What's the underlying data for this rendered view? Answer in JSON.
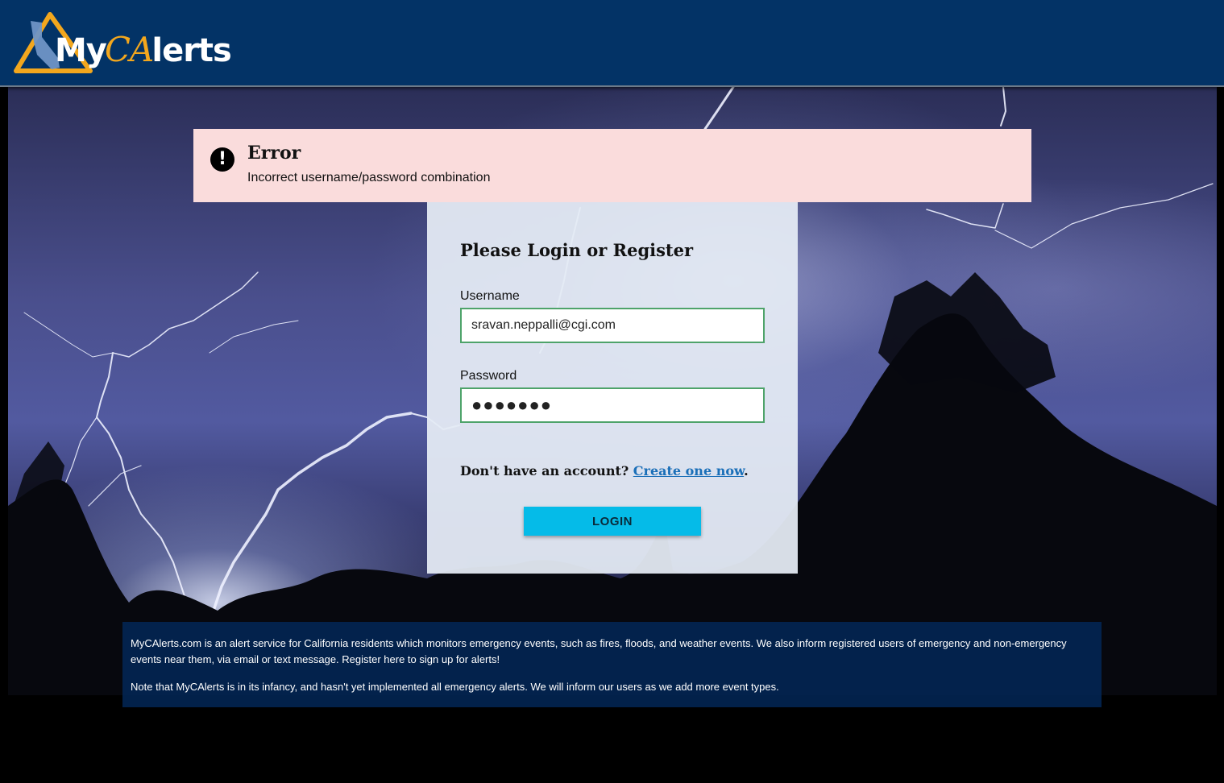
{
  "header": {
    "logo_prefix": "My",
    "logo_ca": "CA",
    "logo_suffix": "lerts"
  },
  "error": {
    "icon": "exclamation-circle-icon",
    "title": "Error",
    "message": "Incorrect username/password combination"
  },
  "login": {
    "title": "Please Login or Register",
    "username_label": "Username",
    "username_value": "sravan.neppalli@cgi.com",
    "password_label": "Password",
    "password_value": "●●●●●●●",
    "signup_prompt": "Don't have an account? ",
    "signup_link": "Create one now",
    "signup_suffix": ".",
    "login_button": "LOGIN"
  },
  "info": {
    "paragraph1": "MyCAlerts.com is an alert service for California residents which monitors emergency events, such as fires, floods, and weather events. We also inform registered users of emergency and non-emergency events near them, via email or text message. Register here to sign up for alerts!",
    "paragraph2": "Note that MyCAlerts is in its infancy, and hasn't yet implemented all emergency alerts. We will inform our users as we add more event types."
  },
  "colors": {
    "header_bg": "#033366",
    "logo_accent": "#f3a71d",
    "error_bg": "#fadcdc",
    "field_border": "#4ea36a",
    "button_bg": "#05bbe8",
    "link": "#1a6fb8"
  }
}
